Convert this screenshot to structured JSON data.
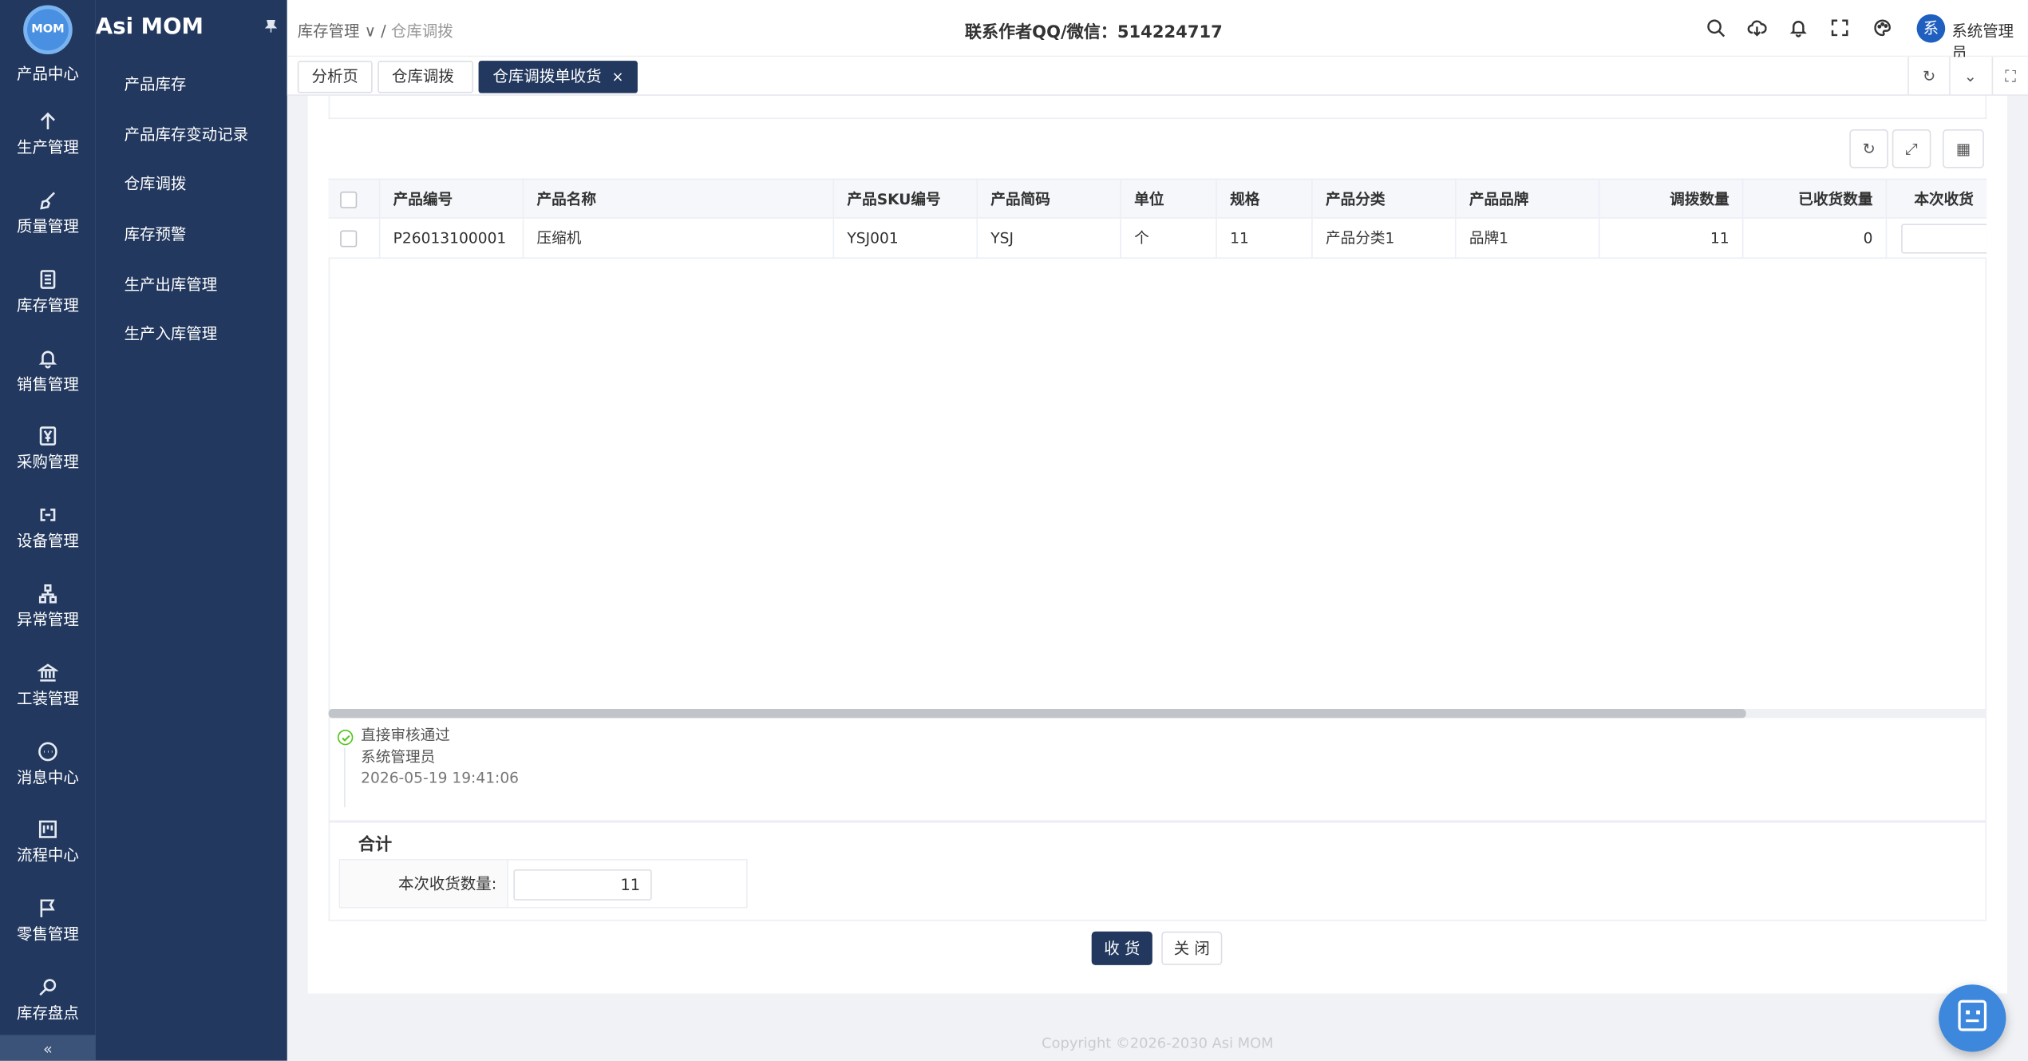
{
  "app": {
    "brand": "Asi MOM",
    "logo_text": "MOM"
  },
  "rail": {
    "items": [
      {
        "label": "产品中心",
        "icon": "product-icon"
      },
      {
        "label": "生产管理",
        "icon": "arrow-up-icon"
      },
      {
        "label": "质量管理",
        "icon": "brush-icon"
      },
      {
        "label": "库存管理",
        "icon": "document-icon"
      },
      {
        "label": "销售管理",
        "icon": "bell-icon"
      },
      {
        "label": "采购管理",
        "icon": "yen-icon"
      },
      {
        "label": "设备管理",
        "icon": "link-icon"
      },
      {
        "label": "异常管理",
        "icon": "tree-icon"
      },
      {
        "label": "工装管理",
        "icon": "bank-icon"
      },
      {
        "label": "消息中心",
        "icon": "chat-icon"
      },
      {
        "label": "流程中心",
        "icon": "flow-icon"
      },
      {
        "label": "零售管理",
        "icon": "flag-icon"
      },
      {
        "label": "库存盘点",
        "icon": "search-icon"
      }
    ],
    "collapse_label": "«"
  },
  "submenu": {
    "pin_icon": "pin-icon",
    "items": [
      "产品库存",
      "产品库存变动记录",
      "仓库调拨",
      "库存预警",
      "生产出库管理",
      "生产入库管理"
    ]
  },
  "header": {
    "breadcrumb": {
      "parent": "库存管理",
      "current": "仓库调拨"
    },
    "contact": "联系作者QQ/微信：514224717",
    "avatar_text": "系",
    "user_name": "系统管理员"
  },
  "tabs": [
    {
      "label": "分析页"
    },
    {
      "label": "仓库调拨"
    },
    {
      "label": "仓库调拨单收货",
      "close": "×"
    }
  ],
  "table": {
    "columns": [
      "产品编号",
      "产品名称",
      "产品SKU编号",
      "产品简码",
      "单位",
      "规格",
      "产品分类",
      "产品品牌",
      "调拨数量",
      "已收货数量",
      "本次收货"
    ],
    "rows": [
      {
        "product_code": "P26013100001",
        "product_name": "压缩机",
        "sku": "YSJ001",
        "short_code": "YSJ",
        "unit": "个",
        "spec": "11",
        "category": "产品分类1",
        "brand": "品牌1",
        "transfer_qty": "11",
        "received_qty": "0",
        "this_receive": ""
      }
    ]
  },
  "timeline": [
    {
      "title": "直接审核通过",
      "user": "系统管理员",
      "time": "2026-05-19 19:41:06"
    }
  ],
  "totals": {
    "title": "合计",
    "label": "本次收货数量:",
    "value": "11"
  },
  "actions": {
    "receive": "收 货",
    "close": "关 闭"
  },
  "footer": "Copyright ©2026-2030 Asi MOM",
  "colors": {
    "sidebar": "#22385f",
    "active_tab": "#22385f",
    "primary_button": "#22385f",
    "fab": "#3d87dd"
  }
}
